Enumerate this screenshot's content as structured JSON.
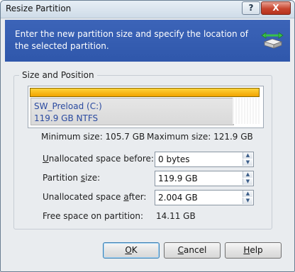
{
  "window": {
    "title": "Resize Partition",
    "help_glyph": "?",
    "close_glyph": "X"
  },
  "banner": {
    "text": "Enter the new partition size and specify the location of the selected partition.",
    "icon": "partition-resize-icon"
  },
  "group": {
    "legend": "Size and Position"
  },
  "partition": {
    "name": "SW_Preload (C:)",
    "info": "119.9 GB  NTFS",
    "used_fraction": 0.88,
    "bar_color": "#f5b400"
  },
  "limits": {
    "minimum": "Minimum size: 105.7 GB",
    "maximum": "Maximum size: 121.9 GB"
  },
  "fields": {
    "unallocated_before": {
      "label_prefix": "U",
      "label_rest": "nallocated space before:",
      "value": "0 bytes"
    },
    "partition_size": {
      "label_prefix": "Partition ",
      "label_ul": "s",
      "label_rest": "ize:",
      "value": "119.9 GB"
    },
    "unallocated_after": {
      "label_prefix": "Unallocated space ",
      "label_ul": "a",
      "label_rest": "fter:",
      "value": "2.004 GB"
    }
  },
  "free_space": {
    "label": "Free space on partition:",
    "value": "14.11 GB"
  },
  "buttons": {
    "ok_ul": "O",
    "ok_rest": "K",
    "cancel_ul": "C",
    "cancel_rest": "ancel",
    "help_ul": "H",
    "help_rest": "elp"
  },
  "colors": {
    "banner": "#3c64b8",
    "partition_bar": "#f5b400",
    "partition_text": "#2a4aa0"
  }
}
